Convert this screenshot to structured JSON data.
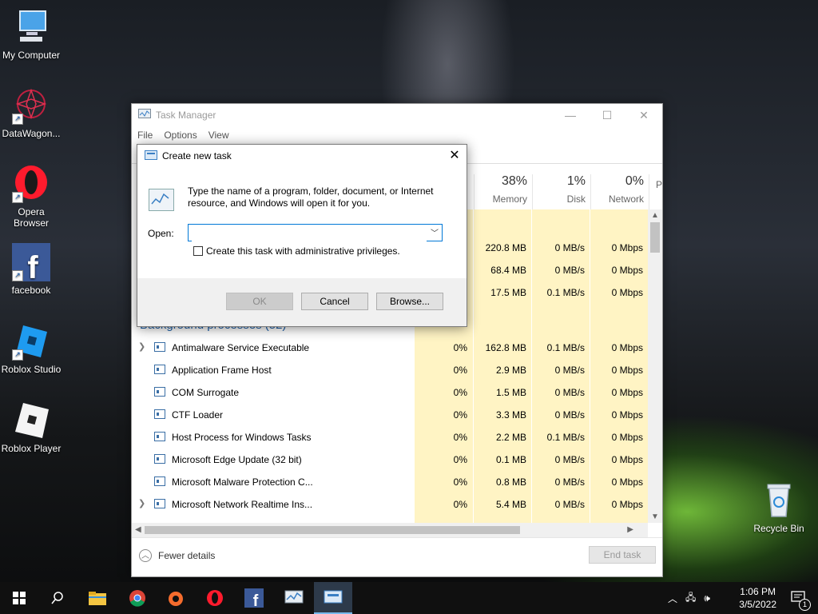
{
  "desktop": {
    "icons": [
      {
        "label": "My Computer"
      },
      {
        "label": "DataWagon..."
      },
      {
        "label": "Opera Browser"
      },
      {
        "label": "facebook"
      },
      {
        "label": "Roblox Studio"
      },
      {
        "label": "Roblox Player"
      },
      {
        "label": "Recycle Bin"
      }
    ]
  },
  "task_manager": {
    "title": "Task Manager",
    "menu": [
      "File",
      "Options",
      "View"
    ],
    "columns": [
      {
        "pct": "",
        "label": ""
      },
      {
        "pct": "38%",
        "label": "Memory"
      },
      {
        "pct": "1%",
        "label": "Disk"
      },
      {
        "pct": "0%",
        "label": "Network"
      },
      {
        "pct": "",
        "label": "P"
      }
    ],
    "app_rows": [
      {
        "memory": "220.8 MB",
        "disk": "0 MB/s",
        "network": "0 Mbps"
      },
      {
        "memory": "68.4 MB",
        "disk": "0 MB/s",
        "network": "0 Mbps"
      },
      {
        "memory": "17.5 MB",
        "disk": "0.1 MB/s",
        "network": "0 Mbps"
      }
    ],
    "background_header": "Background processes (52)",
    "processes": [
      {
        "name": "Antimalware Service Executable",
        "cpu": "0%",
        "memory": "162.8 MB",
        "disk": "0.1 MB/s",
        "network": "0 Mbps",
        "expandable": true
      },
      {
        "name": "Application Frame Host",
        "cpu": "0%",
        "memory": "2.9 MB",
        "disk": "0 MB/s",
        "network": "0 Mbps",
        "expandable": false
      },
      {
        "name": "COM Surrogate",
        "cpu": "0%",
        "memory": "1.5 MB",
        "disk": "0 MB/s",
        "network": "0 Mbps",
        "expandable": false
      },
      {
        "name": "CTF Loader",
        "cpu": "0%",
        "memory": "3.3 MB",
        "disk": "0 MB/s",
        "network": "0 Mbps",
        "expandable": false
      },
      {
        "name": "Host Process for Windows Tasks",
        "cpu": "0%",
        "memory": "2.2 MB",
        "disk": "0.1 MB/s",
        "network": "0 Mbps",
        "expandable": false
      },
      {
        "name": "Microsoft Edge Update (32 bit)",
        "cpu": "0%",
        "memory": "0.1 MB",
        "disk": "0 MB/s",
        "network": "0 Mbps",
        "expandable": false
      },
      {
        "name": "Microsoft Malware Protection C...",
        "cpu": "0%",
        "memory": "0.8 MB",
        "disk": "0 MB/s",
        "network": "0 Mbps",
        "expandable": false
      },
      {
        "name": "Microsoft Network Realtime Ins...",
        "cpu": "0%",
        "memory": "5.4 MB",
        "disk": "0 MB/s",
        "network": "0 Mbps",
        "expandable": true
      }
    ],
    "fewer_details": "Fewer details",
    "end_task": "End task"
  },
  "dialog": {
    "title": "Create new task",
    "message": "Type the name of a program, folder, document, or Internet resource, and Windows will open it for you.",
    "open_label": "Open:",
    "open_value": "",
    "admin_checkbox": "Create this task with administrative privileges.",
    "ok": "OK",
    "cancel": "Cancel",
    "browse": "Browse..."
  },
  "taskbar": {
    "time": "1:06 PM",
    "date": "3/5/2022",
    "notification_count": "1"
  },
  "colors": {
    "accent": "#0078d7",
    "highlight_col": "#fff4c4",
    "section_header": "#1c5fa8"
  }
}
